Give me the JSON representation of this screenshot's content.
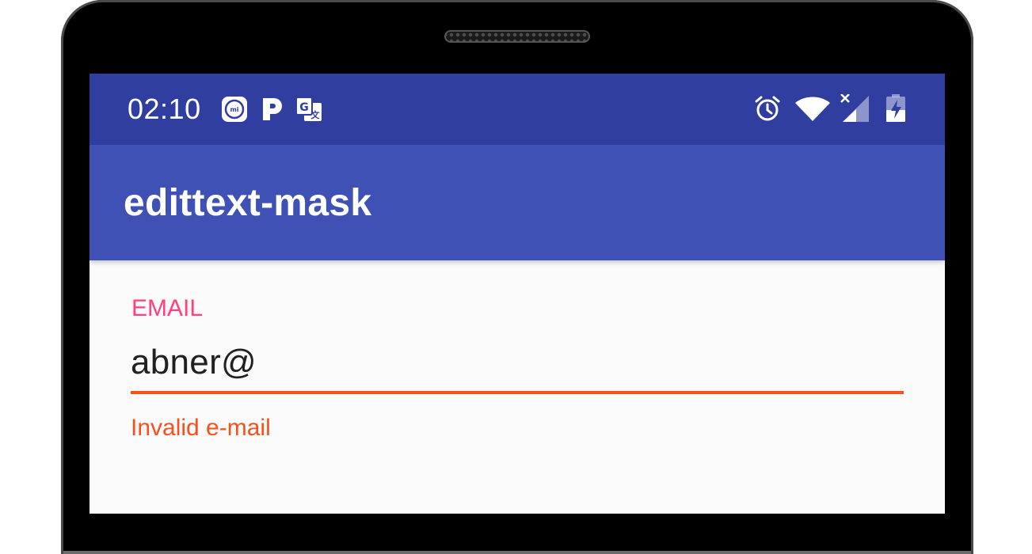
{
  "status_bar": {
    "time": "02:10",
    "notification_icons": [
      "mi-icon",
      "pandora-icon",
      "translate-icon"
    ],
    "system_icons": [
      "alarm-icon",
      "wifi-icon",
      "signal-icon",
      "battery-charging-icon"
    ]
  },
  "app_bar": {
    "title": "edittext-mask"
  },
  "email_field": {
    "label": "EMAIL",
    "value": "abner@",
    "error": "Invalid e-mail"
  },
  "colors": {
    "status_bar": "#303f9f",
    "app_bar": "#3f51b5",
    "accent": "#ff4081",
    "error": "#f4511e",
    "background": "#fafafa"
  }
}
